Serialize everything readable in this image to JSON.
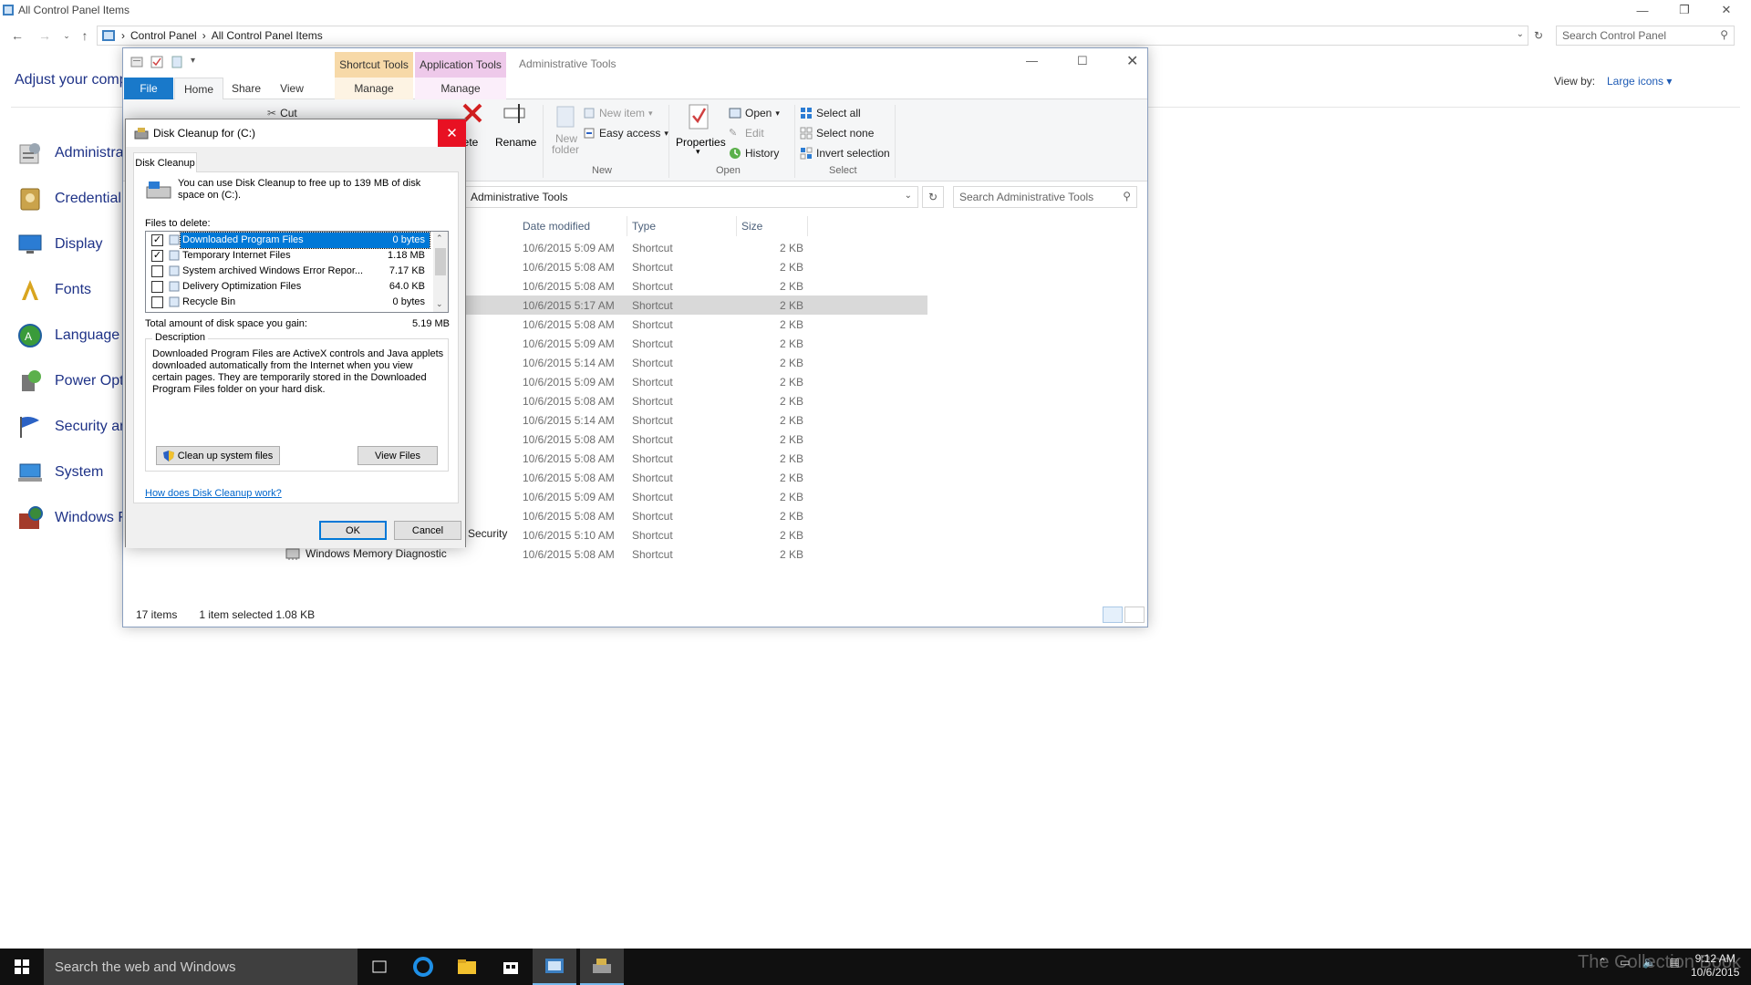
{
  "control_panel": {
    "title": "All Control Panel Items",
    "breadcrumb": [
      "Control Panel",
      "All Control Panel Items"
    ],
    "search_placeholder": "Search Control Panel",
    "heading": "Adjust your comp",
    "view_by_label": "View by:",
    "view_by_value": "Large icons",
    "items": [
      {
        "label": "Administra",
        "icon": "administrative-tools-icon"
      },
      {
        "label": "Credential",
        "icon": "credential-manager-icon"
      },
      {
        "label": "Display",
        "icon": "display-icon"
      },
      {
        "label": "Fonts",
        "icon": "fonts-icon"
      },
      {
        "label": "Language",
        "icon": "language-icon"
      },
      {
        "label": "Power Opt",
        "icon": "power-options-icon"
      },
      {
        "label": "Security ar",
        "icon": "security-flag-icon"
      },
      {
        "label": "System",
        "icon": "system-icon"
      },
      {
        "label": "Windows F",
        "icon": "windows-firewall-icon"
      }
    ]
  },
  "explorer": {
    "window_title": "Administrative Tools",
    "context_tabs": {
      "shortcut": "Shortcut Tools",
      "application": "Application Tools"
    },
    "tabs": {
      "file": "File",
      "home": "Home",
      "share": "Share",
      "view": "View",
      "manage1": "Manage",
      "manage2": "Manage"
    },
    "ribbon": {
      "cut": "Cut",
      "delete": "lete",
      "rename": "Rename",
      "new_item": "New item",
      "easy_access": "Easy access",
      "new_folder_1": "New",
      "new_folder_2": "folder",
      "group_new": "New",
      "properties": "Properties",
      "open": "Open",
      "edit": "Edit",
      "history": "History",
      "group_open": "Open",
      "select_all": "Select all",
      "select_none": "Select none",
      "invert_selection": "Invert selection",
      "group_select": "Select"
    },
    "address": "Administrative Tools",
    "search_placeholder": "Search Administrative Tools",
    "columns": {
      "date": "Date modified",
      "type": "Type",
      "size": "Size"
    },
    "rows": [
      {
        "name": "",
        "date": "10/6/2015 5:09 AM",
        "type": "Shortcut",
        "size": "2 KB"
      },
      {
        "name": "",
        "date": "10/6/2015 5:08 AM",
        "type": "Shortcut",
        "size": "2 KB"
      },
      {
        "name": "",
        "date": "10/6/2015 5:08 AM",
        "type": "Shortcut",
        "size": "2 KB"
      },
      {
        "name": "",
        "date": "10/6/2015 5:17 AM",
        "type": "Shortcut",
        "size": "2 KB"
      },
      {
        "name": "",
        "date": "10/6/2015 5:08 AM",
        "type": "Shortcut",
        "size": "2 KB"
      },
      {
        "name": "",
        "date": "10/6/2015 5:09 AM",
        "type": "Shortcut",
        "size": "2 KB"
      },
      {
        "name": "",
        "date": "10/6/2015 5:14 AM",
        "type": "Shortcut",
        "size": "2 KB"
      },
      {
        "name": "",
        "date": "10/6/2015 5:09 AM",
        "type": "Shortcut",
        "size": "2 KB"
      },
      {
        "name": "",
        "date": "10/6/2015 5:08 AM",
        "type": "Shortcut",
        "size": "2 KB"
      },
      {
        "name": "",
        "date": "10/6/2015 5:14 AM",
        "type": "Shortcut",
        "size": "2 KB"
      },
      {
        "name": "",
        "date": "10/6/2015 5:08 AM",
        "type": "Shortcut",
        "size": "2 KB"
      },
      {
        "name": "",
        "date": "10/6/2015 5:08 AM",
        "type": "Shortcut",
        "size": "2 KB"
      },
      {
        "name": "",
        "date": "10/6/2015 5:08 AM",
        "type": "Shortcut",
        "size": "2 KB"
      },
      {
        "name": "",
        "date": "10/6/2015 5:09 AM",
        "type": "Shortcut",
        "size": "2 KB"
      },
      {
        "name": "",
        "date": "10/6/2015 5:08 AM",
        "type": "Shortcut",
        "size": "2 KB"
      },
      {
        "name": "Security",
        "date": "10/6/2015 5:10 AM",
        "type": "Shortcut",
        "size": "2 KB"
      },
      {
        "name": "Windows Memory Diagnostic",
        "date": "10/6/2015 5:08 AM",
        "type": "Shortcut",
        "size": "2 KB"
      }
    ],
    "selected_row": 3,
    "status_items": "17 items",
    "status_selected": "1 item selected  1.08 KB"
  },
  "disk_cleanup": {
    "title": "Disk Cleanup for  (C:)",
    "tab": "Disk Cleanup",
    "intro": "You can use Disk Cleanup to free up to 139 MB of disk space on  (C:).",
    "files_to_delete_label": "Files to delete:",
    "files": [
      {
        "checked": true,
        "label": "Downloaded Program Files",
        "size": "0 bytes",
        "selected": true
      },
      {
        "checked": true,
        "label": "Temporary Internet Files",
        "size": "1.18 MB",
        "selected": false
      },
      {
        "checked": false,
        "label": "System archived Windows Error Repor...",
        "size": "7.17 KB",
        "selected": false
      },
      {
        "checked": false,
        "label": "Delivery Optimization Files",
        "size": "64.0 KB",
        "selected": false
      },
      {
        "checked": false,
        "label": "Recycle Bin",
        "size": "0 bytes",
        "selected": false
      }
    ],
    "total_label": "Total amount of disk space you gain:",
    "total_value": "5.19 MB",
    "description_label": "Description",
    "description": "Downloaded Program Files are ActiveX controls and Java applets downloaded automatically from the Internet when you view certain pages. They are temporarily stored in the Downloaded Program Files folder on your hard disk.",
    "cleanup_system_files": "Clean up system files",
    "view_files": "View Files",
    "help_link": "How does Disk Cleanup work?",
    "ok": "OK",
    "cancel": "Cancel"
  },
  "taskbar": {
    "search_placeholder": "Search the web and Windows",
    "clock_time": "9:12 AM",
    "clock_date": "10/6/2015",
    "watermark": "The Collection Book"
  },
  "colors": {
    "accent": "#1979ca",
    "dialog_close": "#e81123",
    "selection": "#0078d7",
    "link": "#1e3287"
  }
}
